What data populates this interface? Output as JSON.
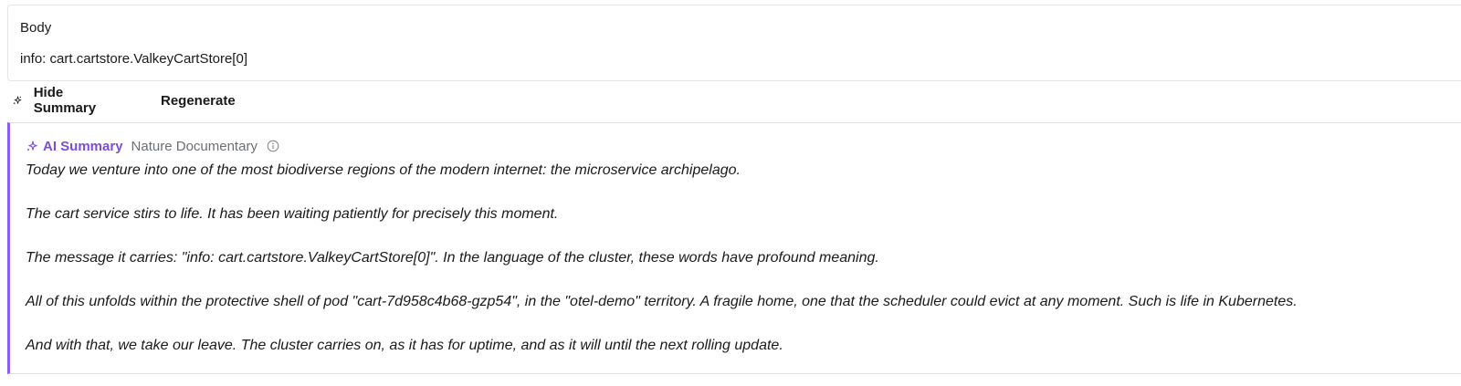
{
  "body_section": {
    "label": "Body",
    "value": "info: cart.cartstore.ValkeyCartStore[0]"
  },
  "toolbar": {
    "hide_summary_label": "Hide Summary",
    "regenerate_label": "Regenerate"
  },
  "summary": {
    "title": "AI Summary",
    "style": "Nature Documentary",
    "accent_color": "#8b5cf6",
    "paragraphs": [
      "Today we venture into one of the most biodiverse regions of the modern internet: the microservice archipelago.",
      "The cart service stirs to life. It has been waiting patiently for precisely this moment.",
      "The message it carries: \"info: cart.cartstore.ValkeyCartStore[0]\". In the language of the cluster, these words have profound meaning.",
      "All of this unfolds within the protective shell of pod \"cart-7d958c4b68-gzp54\", in the \"otel-demo\" territory. A fragile home, one that the scheduler could evict at any moment. Such is life in Kubernetes.",
      "And with that, we take our leave. The cluster carries on, as it has for uptime, and as it will until the next rolling update."
    ]
  }
}
